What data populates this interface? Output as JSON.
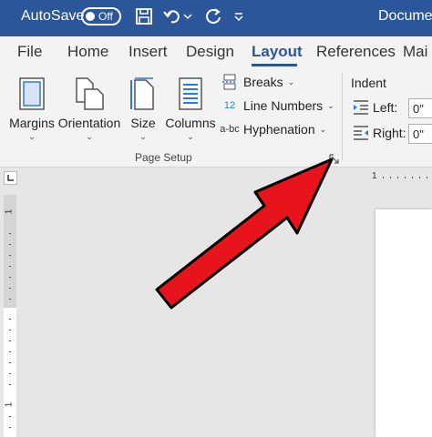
{
  "titlebar": {
    "autosave_label": "AutoSave",
    "autosave_state": "Off",
    "document_title": "Document"
  },
  "tabs": [
    {
      "label": "File",
      "active": false
    },
    {
      "label": "Home",
      "active": false
    },
    {
      "label": "Insert",
      "active": false
    },
    {
      "label": "Design",
      "active": false
    },
    {
      "label": "Layout",
      "active": true
    },
    {
      "label": "References",
      "active": false
    },
    {
      "label": "Mai",
      "active": false
    }
  ],
  "page_setup": {
    "margins": "Margins",
    "orientation": "Orientation",
    "size": "Size",
    "columns": "Columns",
    "breaks": "Breaks",
    "line_numbers": "Line Numbers",
    "hyphenation": "Hyphenation",
    "hyphenation_icon_text": "a-bc",
    "line_numbers_icon_text": "12",
    "group_label": "Page Setup"
  },
  "indent": {
    "title": "Indent",
    "left_label": "Left:",
    "left_value": "0\"",
    "right_label": "Right:",
    "right_value": "0\""
  },
  "rulers": {
    "horizontal_digit": "1",
    "vertical_digit_1": "1",
    "vertical_digit_2": "1"
  },
  "colors": {
    "accent": "#2b579a",
    "arrow": "#e8141b"
  }
}
